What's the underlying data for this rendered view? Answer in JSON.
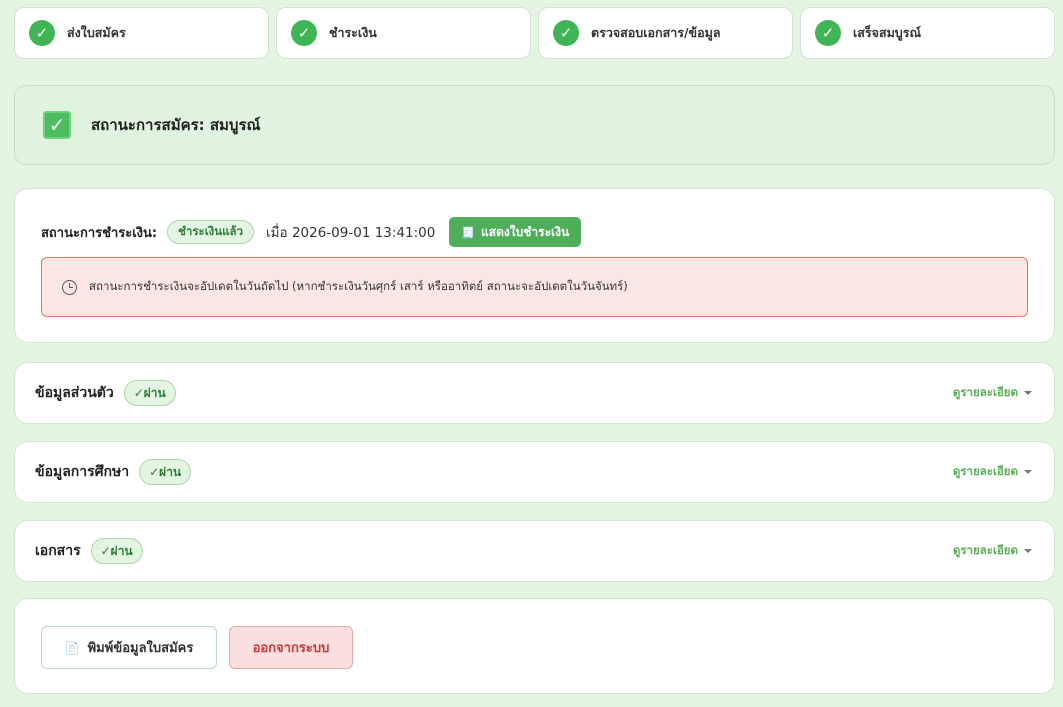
{
  "steps": [
    {
      "label": "ส่งใบสมัคร",
      "check": "✓"
    },
    {
      "label": "ชำระเงิน",
      "check": "✓"
    },
    {
      "label": "ตรวจสอบเอกสาร/ข้อมูล",
      "check": "✓"
    },
    {
      "label": "เสร็จสมบูรณ์",
      "check": "✓"
    }
  ],
  "status": {
    "check": "✓",
    "title": "สถานะการสมัคร: สมบูรณ์"
  },
  "payment": {
    "label": "สถานะการชำระเงิน:",
    "badge": "ชำระเงินแล้ว",
    "time": "เมื่อ 2026-09-01 13:41:00",
    "receipt_icon": "🧾",
    "receipt_button": "แสดงใบชำระเงิน",
    "alert": "สถานะการชำระเงินจะอัปเดตในวันถัดไป (หากชำระเงินวันศุกร์ เสาร์ หรืออาทิตย์ สถานะจะอัปเดตในวันจันทร์)"
  },
  "sections": [
    {
      "title": "ข้อมูลส่วนตัว",
      "badge": "✓ผ่าน",
      "link": "ดูรายละเอียด"
    },
    {
      "title": "ข้อมูลการศึกษา",
      "badge": "✓ผ่าน",
      "link": "ดูรายละเอียด"
    },
    {
      "title": "เอกสาร",
      "badge": "✓ผ่าน",
      "link": "ดูรายละเอียด"
    }
  ],
  "actions": {
    "print_icon": "📄",
    "print": "พิมพ์ข้อมูลใบสมัคร",
    "logout": "ออกจากระบบ"
  },
  "colors": {
    "background": "#e4f5e2",
    "accent_green": "#3fb556",
    "alert_bg": "#fce6e3",
    "alert_border": "#d8776c",
    "logout_text": "#c53a3a"
  }
}
